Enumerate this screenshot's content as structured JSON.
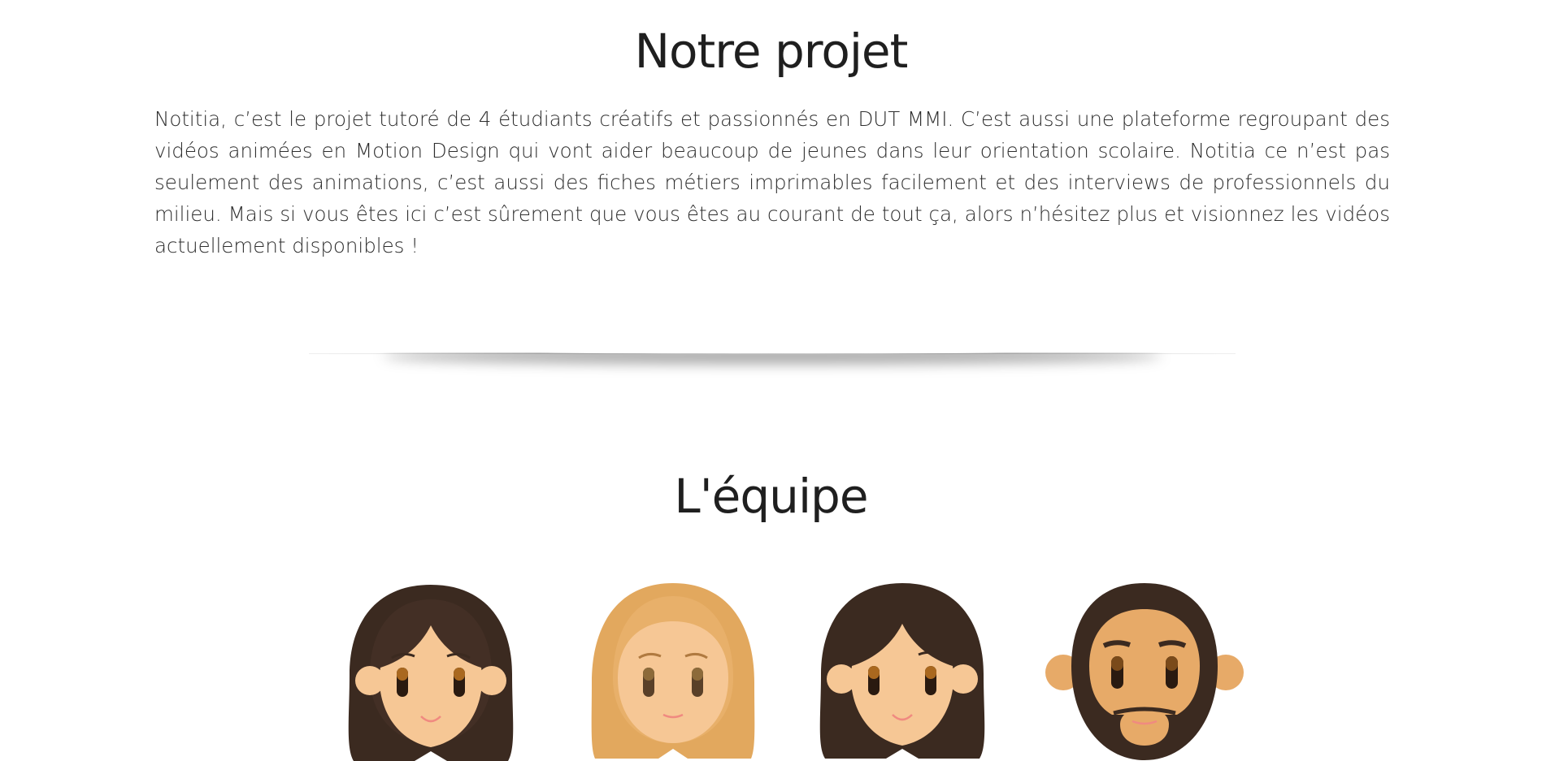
{
  "projet": {
    "title": "Notre projet",
    "description": "Notitia, c’est le projet tutoré de 4 étudiants créatifs et passionnés en DUT MMI. C’est aussi une plateforme regroupant des vidéos animées en Motion Design qui vont aider beaucoup de jeunes dans leur orientation scolaire. Notitia ce n’est pas seulement des animations, c’est aussi des fiches métiers imprimables facilement et des interviews de professionnels du milieu. Mais si vous êtes ici c’est sûrement que vous êtes au courant de tout ça, alors n’hésitez plus et visionnez les vidéos actuellement disponibles !"
  },
  "equipe": {
    "title": "L'équipe",
    "members": [
      {
        "avatar": "avatar-dark-hair-woman",
        "hair_color": "#3b2a20",
        "skin_color": "#f6c795"
      },
      {
        "avatar": "avatar-blonde-hair-woman",
        "hair_color": "#e2a85e",
        "skin_color": "#f6c795"
      },
      {
        "avatar": "avatar-dark-hair-woman-2",
        "hair_color": "#3b2a20",
        "skin_color": "#f6c795"
      },
      {
        "avatar": "avatar-bearded-man",
        "hair_color": "#3b2a20",
        "skin_color": "#e7aa68"
      }
    ]
  }
}
